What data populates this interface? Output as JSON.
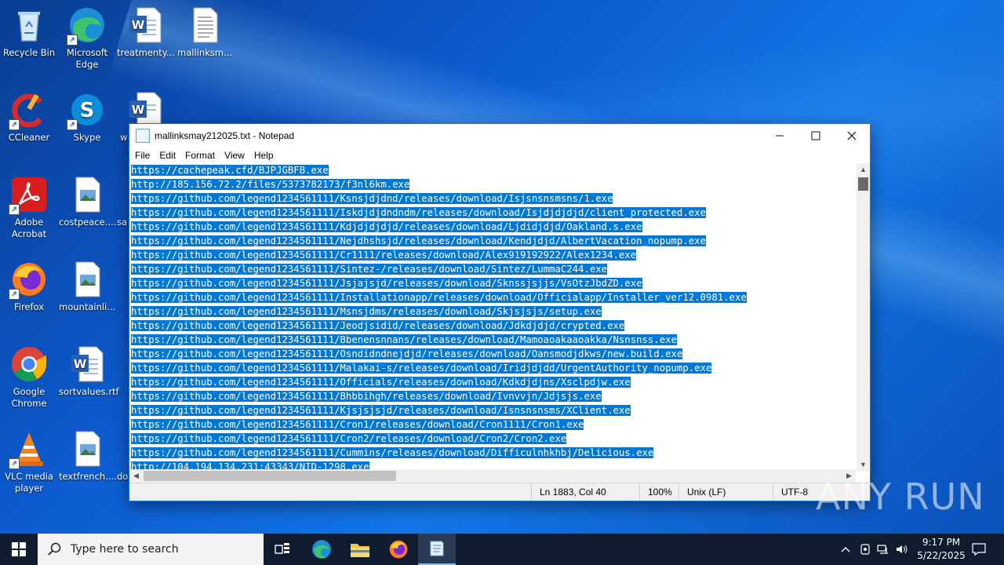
{
  "desktop": {
    "icons": [
      {
        "label": "Recycle Bin"
      },
      {
        "label": "Microsoft\nEdge"
      },
      {
        "label": "treatmenty..."
      },
      {
        "label": "mallinksm..."
      },
      {
        "label": "CCleaner"
      },
      {
        "label": "Skype"
      },
      {
        "label": "w"
      },
      {
        "label": "Adobe\nAcrobat"
      },
      {
        "label": "costpeace...."
      },
      {
        "label": "sa"
      },
      {
        "label": "Firefox"
      },
      {
        "label": "mountainli..."
      },
      {
        "label": "Google\nChrome"
      },
      {
        "label": "sortvalues.rtf"
      },
      {
        "label": "VLC media\nplayer"
      },
      {
        "label": "textfrench...."
      },
      {
        "label": "do"
      }
    ]
  },
  "notepad": {
    "title": "mallinksmay212025.txt - Notepad",
    "menu": [
      "File",
      "Edit",
      "Format",
      "View",
      "Help"
    ],
    "lines": [
      "https://cachepeak.cfd/BJPJGBFB.exe",
      "http://185.156.72.2/files/5373782173/f3nl6km.exe",
      "https://github.com/legend1234561111/Ksnsjdjdnd/releases/download/Isjsnsnsmsns/1.exe",
      "https://github.com/legend1234561111/Iskdjdjdndndm/releases/download/Isjdjdjdjd/client_protected.exe",
      "https://github.com/legend1234561111/Kdjdjdjdjd/releases/download/Ljdidjdjd/Oakland.s.exe",
      "https://github.com/legend1234561111/Nejdhshsjd/releases/download/Kendjdjd/AlbertVacation_nopump.exe",
      "https://github.com/legend1234561111/Cr1111/releases/download/Alex919192922/Alex1234.exe",
      "https://github.com/legend1234561111/Sintez-/releases/download/Sintez/LummaC244.exe",
      "https://github.com/legend1234561111/Jsjajsjd/releases/download/Sknssjsjjs/VsOtzJbdZD.exe",
      "https://github.com/legend1234561111/Installationapp/releases/download/Officialapp/Installer_ver12.0981.exe",
      "https://github.com/legend1234561111/Msnsjdms/releases/download/Skjsjsjs/setup.exe",
      "https://github.com/legend1234561111/Jeodjsidid/releases/download/Jdkdjdjd/crypted.exe",
      "https://github.com/legend1234561111/Bbenensnnans/releases/download/Mamoaoakaaoakka/Nsnsnss.exe",
      "https://github.com/legend1234561111/Osndidndnejdjd/releases/download/Oansmodjdkws/new.build.exe",
      "https://github.com/legend1234561111/Malakai-s/releases/download/Iridjdjdd/UrgentAuthority_nopump.exe",
      "https://github.com/legend1234561111/Officials/releases/download/Kdkdjdjns/Xsclpdjw.exe",
      "https://github.com/legend1234561111/Bhbbihgh/releases/download/Ivnvvjn/Jdjsjs.exe",
      "https://github.com/legend1234561111/Kjsjsjsjd/releases/download/Isnsnsnsms/XClient.exe",
      "https://github.com/legend1234561111/Cron1/releases/download/Cron1111/Cron1.exe",
      "https://github.com/legend1234561111/Cron2/releases/download/Cron2/Cron2.exe",
      "https://github.com/legend1234561111/Cummins/releases/download/Difficulnhkhbj/Delicious.exe",
      "http://104.194.134.231:43343/NID-1298.exe"
    ],
    "status": {
      "position": "Ln 1883, Col 40",
      "zoom": "100%",
      "line_ending": "Unix (LF)",
      "encoding": "UTF-8"
    }
  },
  "taskbar": {
    "search_placeholder": "Type here to search",
    "time": "9:17 PM",
    "date": "5/22/2025"
  },
  "watermark": "ANY RUN",
  "colors": {
    "selection": "#0078d7",
    "taskbar": "#0f1b2e",
    "desktop": "#0d5bd0"
  }
}
